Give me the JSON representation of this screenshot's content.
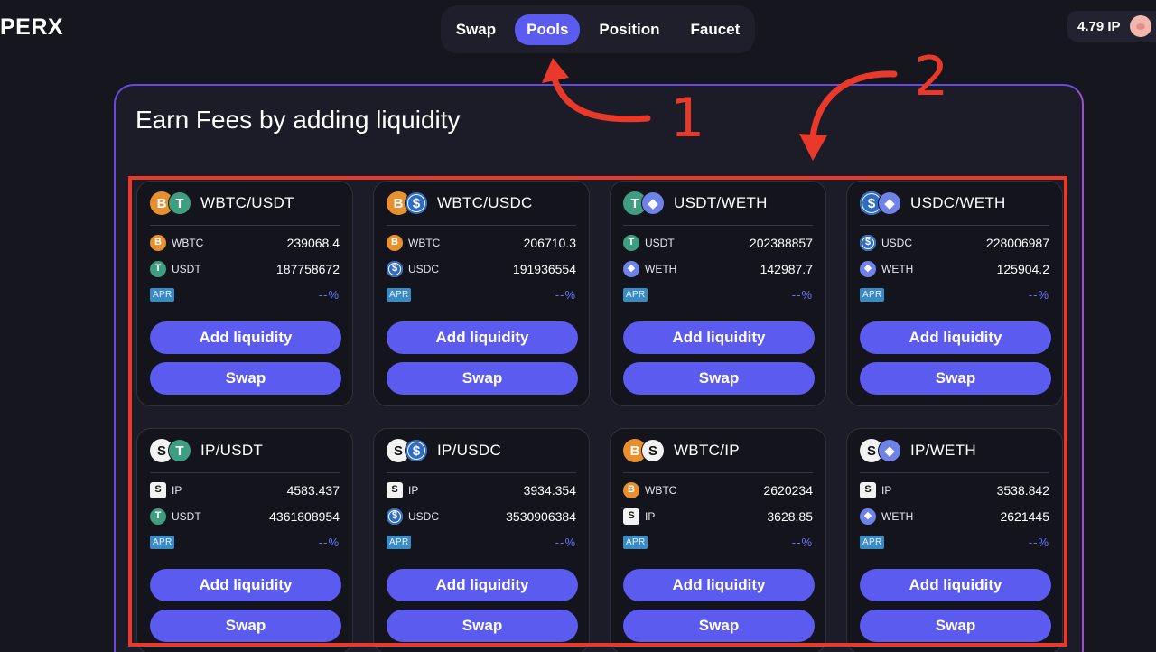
{
  "header": {
    "logo": "PERX",
    "nav": [
      {
        "label": "Swap",
        "active": false
      },
      {
        "label": "Pools",
        "active": true
      },
      {
        "label": "Position",
        "active": false
      },
      {
        "label": "Faucet",
        "active": false
      }
    ],
    "balance": "4.79 IP"
  },
  "panel": {
    "title": "Earn Fees by adding liquidity"
  },
  "pools": [
    {
      "pair": "WBTC/USDT",
      "icons": [
        "btc",
        "usdt"
      ],
      "tokens": [
        {
          "symbol": "WBTC",
          "icon": "btc",
          "amount": "239068.4"
        },
        {
          "symbol": "USDT",
          "icon": "usdt",
          "amount": "187758672"
        }
      ],
      "apr_label": "APR",
      "apr": "--%",
      "add_label": "Add liquidity",
      "swap_label": "Swap"
    },
    {
      "pair": "WBTC/USDC",
      "icons": [
        "btc",
        "usdc"
      ],
      "tokens": [
        {
          "symbol": "WBTC",
          "icon": "btc",
          "amount": "206710.3"
        },
        {
          "symbol": "USDC",
          "icon": "usdc",
          "amount": "191936554"
        }
      ],
      "apr_label": "APR",
      "apr": "--%",
      "add_label": "Add liquidity",
      "swap_label": "Swap"
    },
    {
      "pair": "USDT/WETH",
      "icons": [
        "usdt",
        "eth"
      ],
      "tokens": [
        {
          "symbol": "USDT",
          "icon": "usdt",
          "amount": "202388857"
        },
        {
          "symbol": "WETH",
          "icon": "eth",
          "amount": "142987.7"
        }
      ],
      "apr_label": "APR",
      "apr": "--%",
      "add_label": "Add liquidity",
      "swap_label": "Swap"
    },
    {
      "pair": "USDC/WETH",
      "icons": [
        "usdc",
        "eth"
      ],
      "tokens": [
        {
          "symbol": "USDC",
          "icon": "usdc",
          "amount": "228006987"
        },
        {
          "symbol": "WETH",
          "icon": "eth",
          "amount": "125904.2"
        }
      ],
      "apr_label": "APR",
      "apr": "--%",
      "add_label": "Add liquidity",
      "swap_label": "Swap"
    },
    {
      "pair": "IP/USDT",
      "icons": [
        "ip",
        "usdt"
      ],
      "tokens": [
        {
          "symbol": "IP",
          "icon": "ip",
          "amount": "4583.437"
        },
        {
          "symbol": "USDT",
          "icon": "usdt",
          "amount": "4361808954"
        }
      ],
      "apr_label": "APR",
      "apr": "--%",
      "add_label": "Add liquidity",
      "swap_label": "Swap"
    },
    {
      "pair": "IP/USDC",
      "icons": [
        "ip",
        "usdc"
      ],
      "tokens": [
        {
          "symbol": "IP",
          "icon": "ip",
          "amount": "3934.354"
        },
        {
          "symbol": "USDC",
          "icon": "usdc",
          "amount": "3530906384"
        }
      ],
      "apr_label": "APR",
      "apr": "--%",
      "add_label": "Add liquidity",
      "swap_label": "Swap"
    },
    {
      "pair": "WBTC/IP",
      "icons": [
        "btc",
        "ip"
      ],
      "tokens": [
        {
          "symbol": "WBTC",
          "icon": "btc",
          "amount": "2620234"
        },
        {
          "symbol": "IP",
          "icon": "ip",
          "amount": "3628.85"
        }
      ],
      "apr_label": "APR",
      "apr": "--%",
      "add_label": "Add liquidity",
      "swap_label": "Swap"
    },
    {
      "pair": "IP/WETH",
      "icons": [
        "ip",
        "eth"
      ],
      "tokens": [
        {
          "symbol": "IP",
          "icon": "ip",
          "amount": "3538.842"
        },
        {
          "symbol": "WETH",
          "icon": "eth",
          "amount": "2621445"
        }
      ],
      "apr_label": "APR",
      "apr": "--%",
      "add_label": "Add liquidity",
      "swap_label": "Swap"
    }
  ],
  "annotations": {
    "marker_1": "1",
    "marker_2": "2",
    "color": "#e8392a"
  },
  "colors": {
    "accent": "#5b5bf0",
    "background": "#16161f",
    "card": "#14141d",
    "apr_value": "#6a72ff"
  }
}
